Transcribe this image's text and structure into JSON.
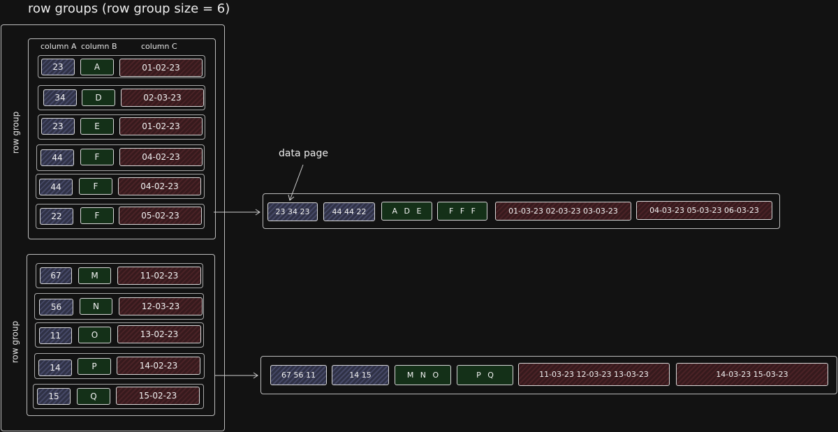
{
  "title": "row groups (row group size = 6)",
  "row_group_label": "row group",
  "columns": [
    "column A",
    "column B",
    "column C"
  ],
  "data_page_label": "data page",
  "group1": {
    "rows": [
      {
        "a": "23",
        "b": "A",
        "c": "01-02-23"
      },
      {
        "a": "34",
        "b": "D",
        "c": "02-03-23"
      },
      {
        "a": "23",
        "b": "E",
        "c": "01-02-23"
      },
      {
        "a": "44",
        "b": "F",
        "c": "04-02-23"
      },
      {
        "a": "44",
        "b": "F",
        "c": "04-02-23"
      },
      {
        "a": "22",
        "b": "F",
        "c": "05-02-23"
      }
    ],
    "pages": [
      {
        "text": "23 34 23",
        "col": "A"
      },
      {
        "text": "44 44 22",
        "col": "A"
      },
      {
        "text": "A D E",
        "col": "B"
      },
      {
        "text": "F F F",
        "col": "B"
      },
      {
        "text": "01-03-23 02-03-23 03-03-23",
        "col": "C"
      },
      {
        "text": "04-03-23 05-03-23 06-03-23",
        "col": "C"
      }
    ]
  },
  "group2": {
    "rows": [
      {
        "a": "67",
        "b": "M",
        "c": "11-02-23"
      },
      {
        "a": "56",
        "b": "N",
        "c": "12-03-23"
      },
      {
        "a": "11",
        "b": "O",
        "c": "13-02-23"
      },
      {
        "a": "14",
        "b": "P",
        "c": "14-02-23"
      },
      {
        "a": "15",
        "b": "Q",
        "c": "15-02-23"
      }
    ],
    "pages": [
      {
        "text": "67 56 11",
        "col": "A"
      },
      {
        "text": "14 15",
        "col": "A"
      },
      {
        "text": "M N O",
        "col": "B"
      },
      {
        "text": "P Q",
        "col": "B"
      },
      {
        "text": "11-03-23 12-03-23 13-03-23",
        "col": "C"
      },
      {
        "text": "14-03-23 15-03-23",
        "col": "C"
      }
    ]
  }
}
